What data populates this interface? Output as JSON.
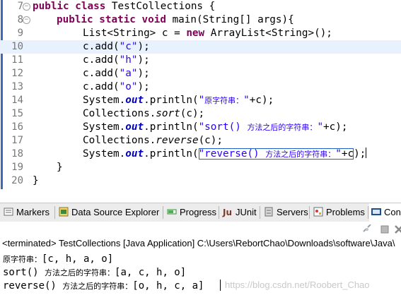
{
  "editor": {
    "lines": [
      {
        "num": "7",
        "fold": "−"
      },
      {
        "num": "8",
        "fold": "−"
      },
      {
        "num": "9",
        "fold": ""
      },
      {
        "num": "10",
        "fold": ""
      },
      {
        "num": "11",
        "fold": ""
      },
      {
        "num": "12",
        "fold": ""
      },
      {
        "num": "13",
        "fold": ""
      },
      {
        "num": "14",
        "fold": ""
      },
      {
        "num": "15",
        "fold": ""
      },
      {
        "num": "16",
        "fold": ""
      },
      {
        "num": "17",
        "fold": ""
      },
      {
        "num": "18",
        "fold": ""
      },
      {
        "num": "19",
        "fold": ""
      },
      {
        "num": "20",
        "fold": ""
      }
    ],
    "code": {
      "l7_kw1": "public",
      "l7_kw2": "class",
      "l7_rest": " TestCollections {",
      "l8_kw1": "public",
      "l8_kw2": "static",
      "l8_kw3": "void",
      "l8_rest": " main(String[] args){",
      "l9_a": "List<String> c = ",
      "l9_kw": "new",
      "l9_b": " ArrayList<String>();",
      "l10_a": "c.add(",
      "l10_s": "\"c\"",
      "l10_b": ");",
      "l11_a": "c.add(",
      "l11_s": "\"h\"",
      "l11_b": ");",
      "l12_a": "c.add(",
      "l12_s": "\"a\"",
      "l12_b": ");",
      "l13_a": "c.add(",
      "l13_s": "\"o\"",
      "l13_b": ");",
      "l14_a": "System.",
      "l14_f": "out",
      "l14_b": ".println(",
      "l14_s1": "\"",
      "l14_cn": "原字符串：",
      "l14_s2": "\"",
      "l14_c": "+c);",
      "l15_a": "Collections.",
      "l15_m": "sort",
      "l15_b": "(c);",
      "l16_a": "System.",
      "l16_f": "out",
      "l16_b": ".println(",
      "l16_s1": "\"sort() ",
      "l16_cn": "方法之后的字符串：",
      "l16_s2": "\"",
      "l16_c": "+c);",
      "l17_a": "Collections.",
      "l17_m": "reverse",
      "l17_b": "(c);",
      "l18_a": "System.",
      "l18_f": "out",
      "l18_b": ".println(",
      "l18_s1": "\"reverse() ",
      "l18_cn": "方法之后的字符串：",
      "l18_s2": "\"",
      "l18_c1": "+c",
      "l18_c2": ");",
      "l19": "}",
      "l20": "}"
    }
  },
  "tabs": [
    {
      "label": "Markers",
      "icon": "markers-icon"
    },
    {
      "label": "Data Source Explorer",
      "icon": "data-source-icon"
    },
    {
      "label": "Progress",
      "icon": "progress-icon"
    },
    {
      "label": "JUnit",
      "icon": "junit-icon"
    },
    {
      "label": "Servers",
      "icon": "servers-icon"
    },
    {
      "label": "Problems",
      "icon": "problems-icon"
    },
    {
      "label": "Con",
      "icon": "console-icon"
    }
  ],
  "console": {
    "status": "<terminated> TestCollections [Java Application] C:\\Users\\RebortChao\\Downloads\\software\\Java\\",
    "out1_cn": "原字符串：",
    "out1": "[c, h, a, o]",
    "out2_a": "sort() ",
    "out2_cn": "方法之后的字符串：",
    "out2_b": "[a, c, h, o]",
    "out3_a": "reverse() ",
    "out3_cn": "方法之后的字符串：",
    "out3_b": "[o, h, c, a]",
    "watermark": "https://blog.csdn.net/Roobert_Chao"
  },
  "colors": {
    "keyword": "#7f0055",
    "string": "#2a00ff",
    "field": "#0000c0",
    "current_line": "#e8f2fe"
  }
}
